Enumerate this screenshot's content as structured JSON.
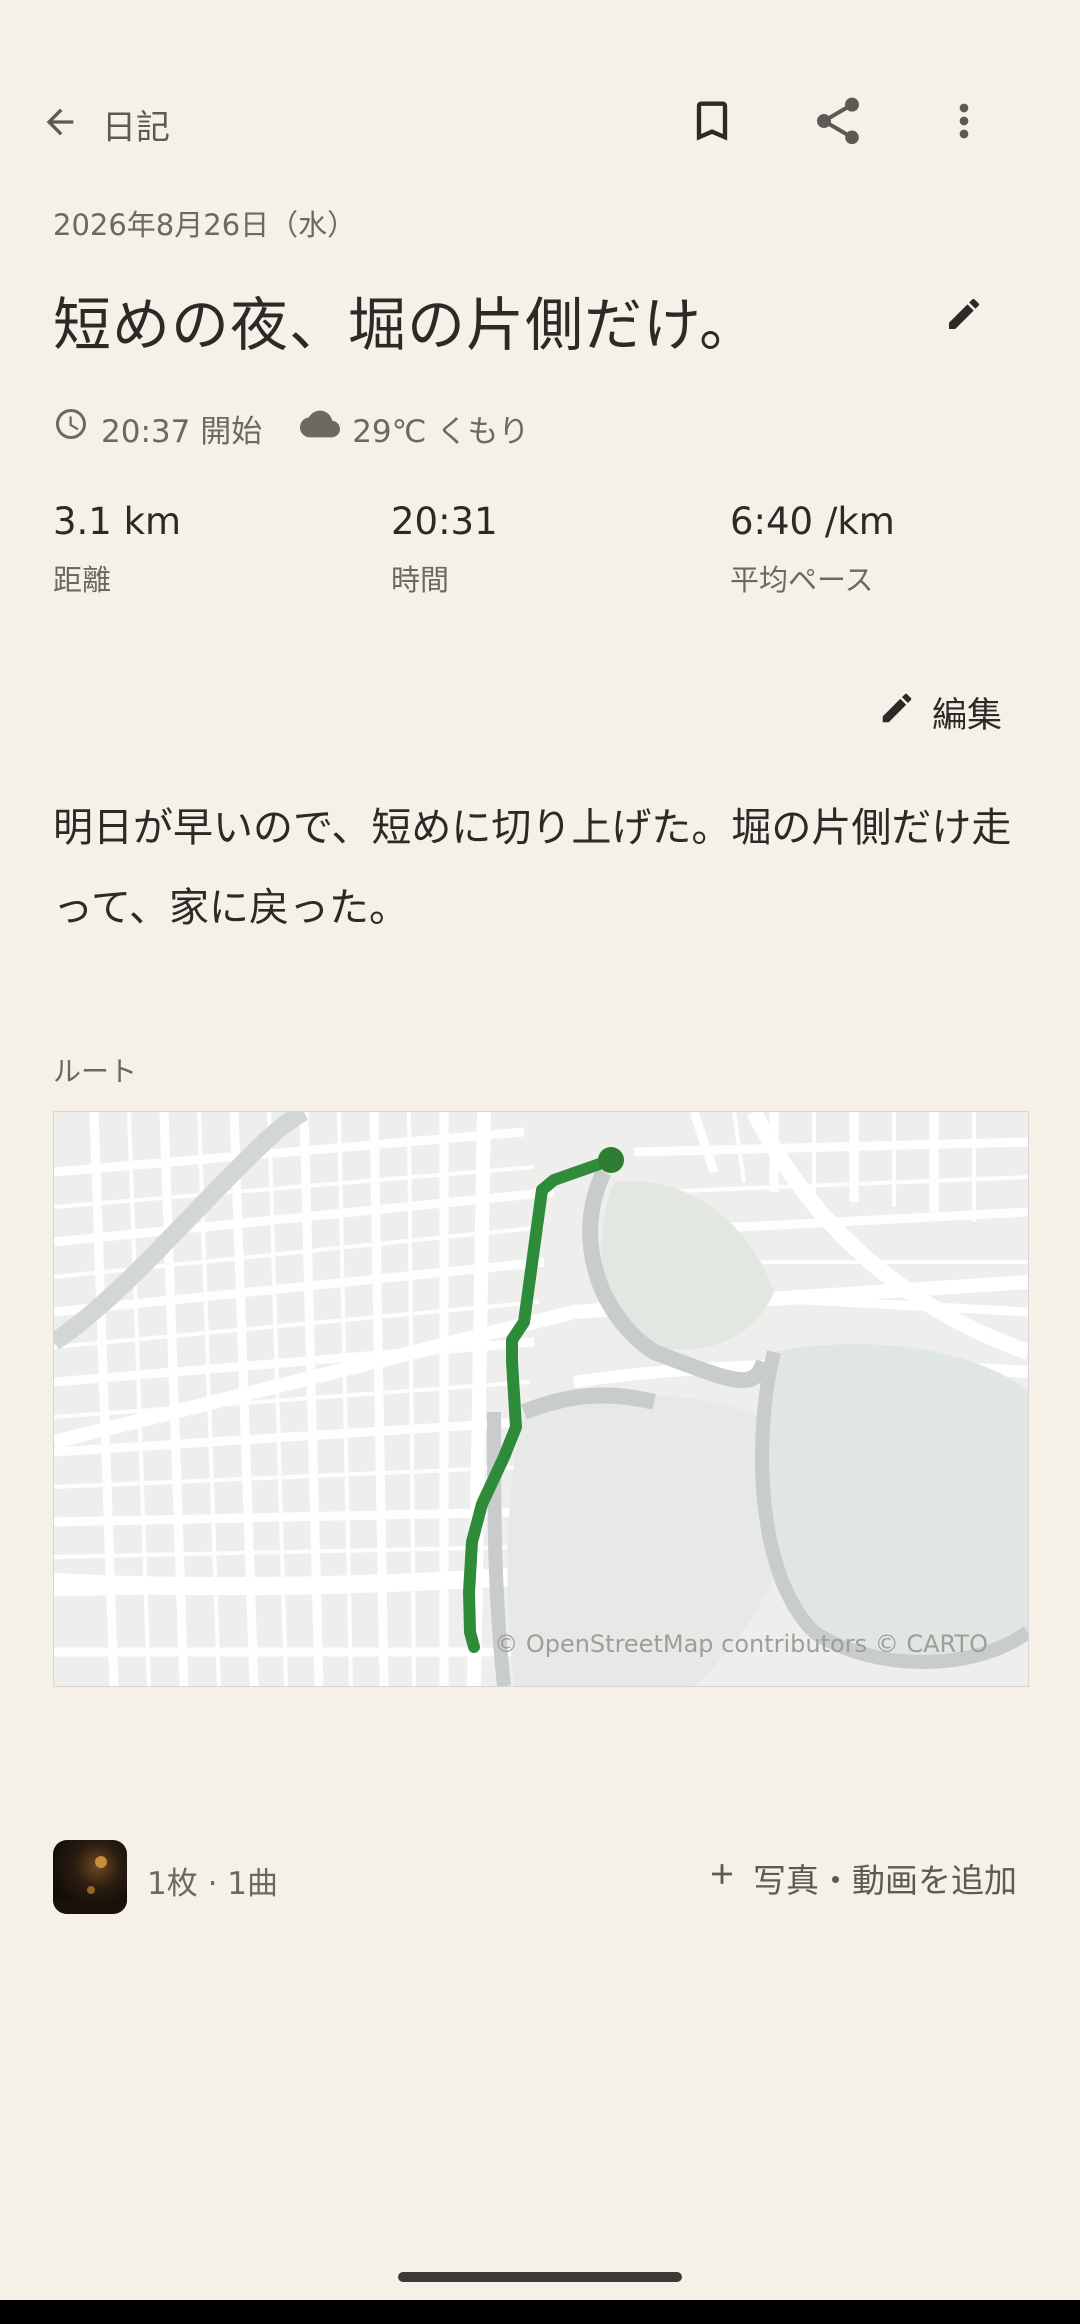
{
  "header": {
    "back_label": "日記",
    "back_icon": "arrow-left-icon",
    "bookmark_icon": "bookmark-icon",
    "share_icon": "share-icon",
    "more_icon": "more-vert-icon"
  },
  "entry": {
    "date": "2026年8月26日（水）",
    "title": "短めの夜、堀の片側だけ。",
    "start_time": "20:37 開始",
    "weather": "29℃ くもり",
    "stats": [
      {
        "value": "3.1 km",
        "label": "距離"
      },
      {
        "value": "20:31",
        "label": "時間"
      },
      {
        "value": "6:40 /km",
        "label": "平均ペース"
      }
    ],
    "edit_label": "編集",
    "body": "明日が早いので、短めに切り上げた。堀の片側だけ走って、家に戻った。"
  },
  "route": {
    "label": "ルート",
    "attribution": "© OpenStreetMap contributors © CARTO",
    "route_color": "#2e8b3a"
  },
  "media": {
    "count": "1枚 · 1曲",
    "add_label": "写真・動画を追加"
  },
  "colors": {
    "background": "#f5f1e8",
    "text": "#2b2a27",
    "muted": "#6c6963",
    "accent": "#2e8b3a"
  }
}
